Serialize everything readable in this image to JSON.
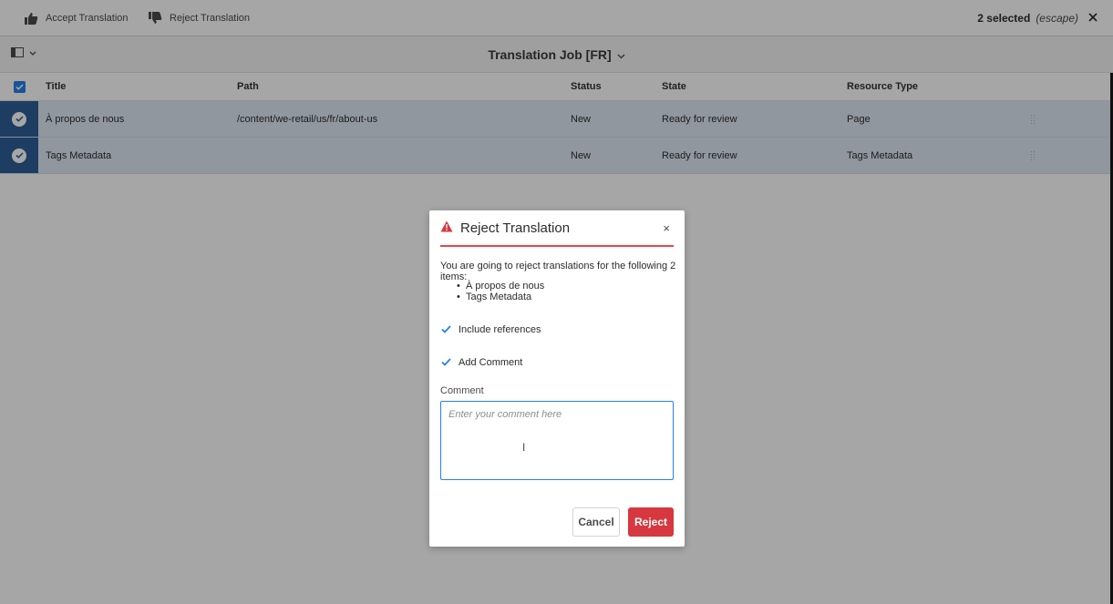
{
  "actionbar": {
    "accept_label": "Accept Translation",
    "reject_label": "Reject Translation",
    "selected_count": "2 selected",
    "escape_hint": "(escape)"
  },
  "titlebar": {
    "title": "Translation Job [FR]"
  },
  "table": {
    "columns": {
      "title": "Title",
      "path": "Path",
      "status": "Status",
      "state": "State",
      "resource_type": "Resource Type"
    },
    "rows": [
      {
        "title": "À propos de nous",
        "path": "/content/we-retail/us/fr/about-us",
        "status": "New",
        "state": "Ready for review",
        "resource_type": "Page"
      },
      {
        "title": "Tags Metadata",
        "path": "",
        "status": "New",
        "state": "Ready for review",
        "resource_type": "Tags Metadata"
      }
    ]
  },
  "dialog": {
    "title": "Reject Translation",
    "close_glyph": "×",
    "intro": "You are going to reject translations for the following 2 items:",
    "items": [
      "À propos de nous",
      "Tags Metadata"
    ],
    "include_references_label": "Include references",
    "include_references_checked": true,
    "add_comment_label": "Add Comment",
    "add_comment_checked": true,
    "comment_label": "Comment",
    "comment_placeholder": "Enter your comment here",
    "comment_value": "",
    "cancel_label": "Cancel",
    "reject_label": "Reject"
  },
  "colors": {
    "accent": "#2680eb",
    "danger": "#d7373f",
    "selected_row": "#dfe9f5",
    "selected_check_cell": "#2d5e97"
  },
  "icons": {
    "accept": "thumbs-up-icon",
    "reject": "thumbs-down-icon",
    "close": "close-icon",
    "rail": "rail-toggle-icon",
    "chevron": "chevron-down-icon",
    "alert": "alert-triangle-icon",
    "check": "checkmark-icon",
    "text_cursor": "text-cursor-icon"
  }
}
